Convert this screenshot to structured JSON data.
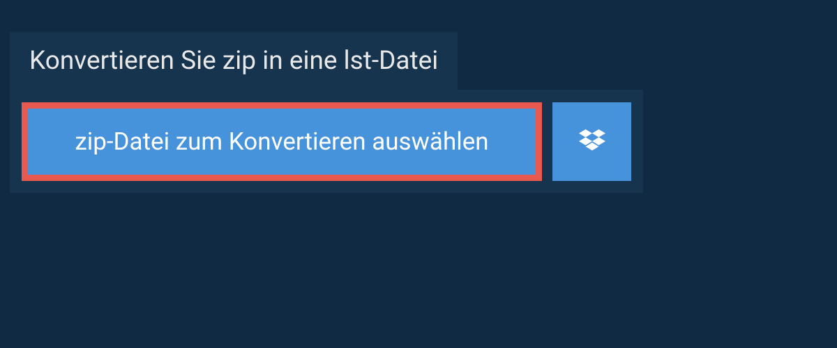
{
  "heading": {
    "title": "Konvertieren Sie zip in eine lst-Datei"
  },
  "upload": {
    "choose_label": "zip-Datei zum Konvertieren auswählen"
  }
}
